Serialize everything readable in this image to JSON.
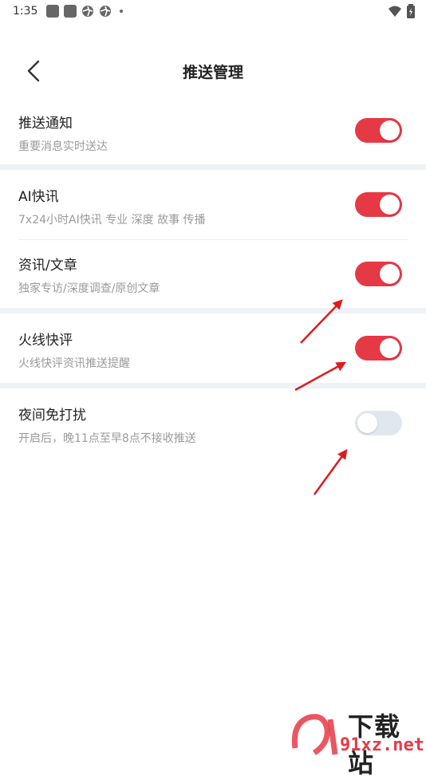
{
  "status_bar": {
    "time": "1:35"
  },
  "header": {
    "title": "推送管理"
  },
  "settings": [
    {
      "title": "推送通知",
      "subtitle": "重要消息实时送达",
      "enabled": true
    },
    {
      "title": "AI快讯",
      "subtitle": "7x24小时AI快讯 专业 深度 故事 传播",
      "enabled": true
    },
    {
      "title": "资讯/文章",
      "subtitle": "独家专访/深度调查/原创文章",
      "enabled": true
    },
    {
      "title": "火线快评",
      "subtitle": "火线快评资讯推送提醒",
      "enabled": true
    },
    {
      "title": "夜间免打扰",
      "subtitle": "开启后，晚11点至早8点不接收推送",
      "enabled": false
    }
  ],
  "colors": {
    "accent": "#e63946",
    "toggle_off": "#e1e7ee",
    "separator": "#eef1f5"
  },
  "watermark": {
    "text_top": "下载站",
    "text_bottom": "91xz.net"
  }
}
